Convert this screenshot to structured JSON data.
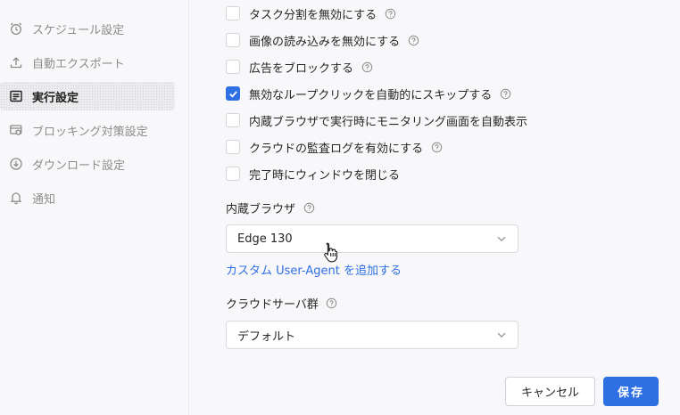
{
  "sidebar": {
    "items": [
      {
        "label": "スケジュール設定",
        "icon": "alarm-clock-icon"
      },
      {
        "label": "自動エクスポート",
        "icon": "upload-icon"
      },
      {
        "label": "実行設定",
        "icon": "list-settings-icon",
        "active": true
      },
      {
        "label": "ブロッキング対策設定",
        "icon": "card-shield-icon"
      },
      {
        "label": "ダウンロード設定",
        "icon": "download-circle-icon"
      },
      {
        "label": "通知",
        "icon": "bell-icon"
      }
    ]
  },
  "options": [
    {
      "label": "タスク分割を無効にする",
      "checked": false,
      "help": true
    },
    {
      "label": "画像の読み込みを無効にする",
      "checked": false,
      "help": true
    },
    {
      "label": "広告をブロックする",
      "checked": false,
      "help": true
    },
    {
      "label": "無効なループクリックを自動的にスキップする",
      "checked": true,
      "help": true
    },
    {
      "label": "内蔵ブラウザで実行時にモニタリング画面を自動表示",
      "checked": false,
      "help": false
    },
    {
      "label": "クラウドの監査ログを有効にする",
      "checked": false,
      "help": true
    },
    {
      "label": "完了時にウィンドウを閉じる",
      "checked": false,
      "help": false
    }
  ],
  "browser": {
    "label": "内蔵ブラウザ",
    "value": "Edge 130",
    "add_ua_link": "カスタム User-Agent を追加する"
  },
  "cloud_group": {
    "label": "クラウドサーバ群",
    "value": "デフォルト"
  },
  "footer": {
    "cancel_label": "キャンセル",
    "save_label": "保存"
  },
  "colors": {
    "accent": "#2f6fe4",
    "sidebar_active_bg": "#ececee"
  }
}
